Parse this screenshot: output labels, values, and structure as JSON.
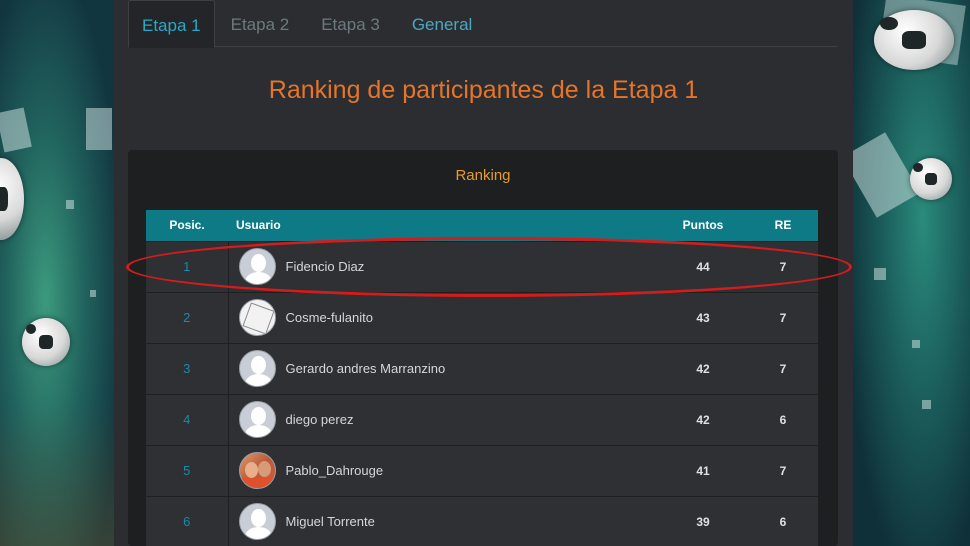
{
  "tabs": [
    {
      "label": "Etapa 1",
      "active": true
    },
    {
      "label": "Etapa 2",
      "active": false
    },
    {
      "label": "Etapa 3",
      "active": false
    },
    {
      "label": "General",
      "active": false
    }
  ],
  "page_title": "Ranking de participantes de la Etapa 1",
  "ranking": {
    "title": "Ranking",
    "columns": {
      "pos": "Posic.",
      "user": "Usuario",
      "points": "Puntos",
      "re": "RE"
    },
    "rows": [
      {
        "pos": "1",
        "user": "Fidencio Diaz",
        "points": "44",
        "re": "7",
        "avatar": "default-avatar"
      },
      {
        "pos": "2",
        "user": "Cosme-fulanito",
        "points": "43",
        "re": "7",
        "avatar": "sketch-avatar"
      },
      {
        "pos": "3",
        "user": "Gerardo andres Marranzino",
        "points": "42",
        "re": "7",
        "avatar": "default-avatar"
      },
      {
        "pos": "4",
        "user": "diego perez",
        "points": "42",
        "re": "6",
        "avatar": "default-avatar"
      },
      {
        "pos": "5",
        "user": "Pablo_Dahrouge",
        "points": "41",
        "re": "7",
        "avatar": "photo-avatar"
      },
      {
        "pos": "6",
        "user": "Miguel Torrente",
        "points": "39",
        "re": "6",
        "avatar": "default-avatar"
      }
    ]
  },
  "colors": {
    "accent_orange": "#e4752b",
    "ranking_title": "#e89a2d",
    "table_header": "#0d7a86",
    "active_tab": "#28a9c8",
    "highlight": "#d31c1c"
  }
}
